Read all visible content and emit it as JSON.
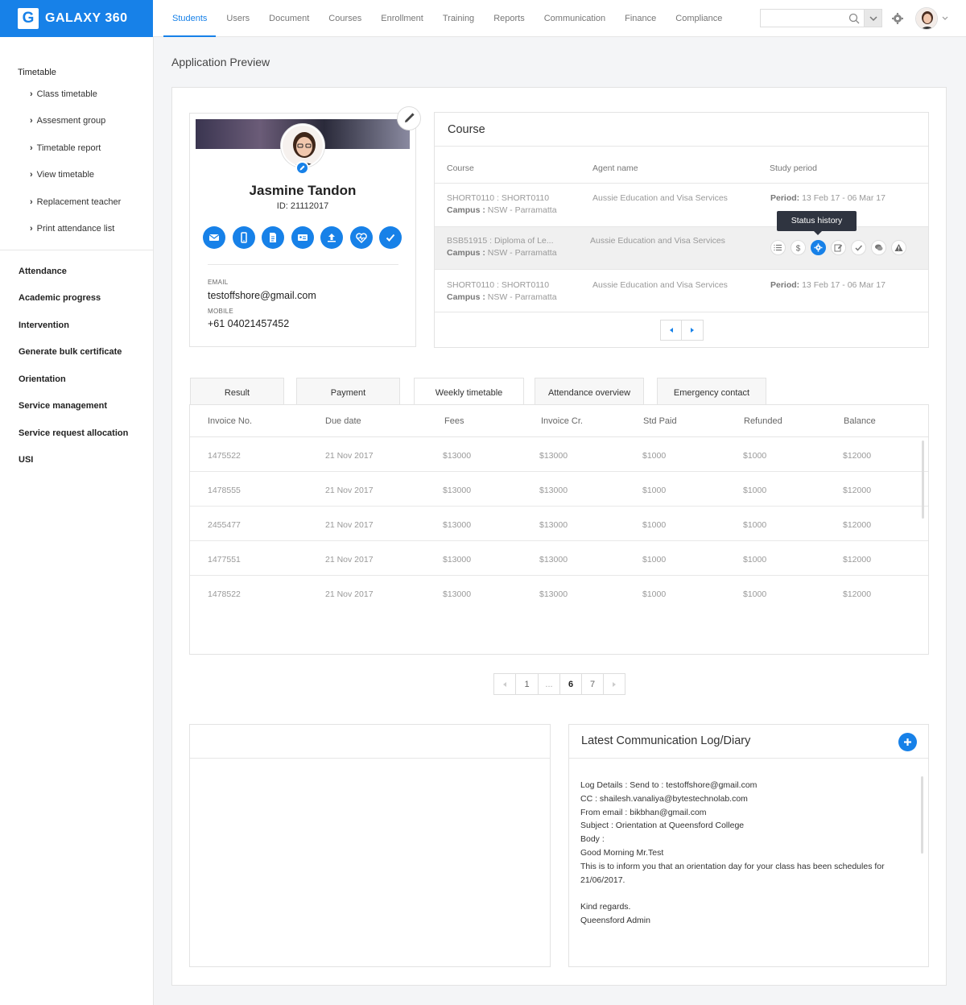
{
  "app": {
    "logo_letter": "G",
    "name": "GALAXY 360"
  },
  "nav": [
    "Students",
    "Users",
    "Document",
    "Courses",
    "Enrollment",
    "Training",
    "Reports",
    "Communication",
    "Finance",
    "Compliance"
  ],
  "search": {
    "placeholder": "",
    "value": ""
  },
  "sidebar": {
    "heading": "Timetable",
    "sub_items": [
      "Class timetable",
      "Assesment group",
      "Timetable report",
      "View timetable",
      "Replacement teacher",
      "Print attendance list"
    ],
    "sections": [
      "Attendance",
      "Academic progress",
      "Intervention",
      "Generate bulk certificate",
      "Orientation",
      "Service management",
      "Service request allocation",
      "USI"
    ]
  },
  "page_title": "Application Preview",
  "profile": {
    "name": "Jasmine Tandon",
    "id": "ID: 21112017",
    "email_label": "EMAIL",
    "email": "testoffshore@gmail.com",
    "mobile_label": "MOBILE",
    "mobile": "+61 04021457452",
    "actions": [
      "mail-icon",
      "mobile-icon",
      "document-icon",
      "id-card-icon",
      "upload-icon",
      "health-icon",
      "check-icon"
    ]
  },
  "course": {
    "title": "Course",
    "headers": [
      "Course",
      "Agent name",
      "Study period"
    ],
    "rows": [
      {
        "course": "SHORT0110 : SHORT0110",
        "campus_label": "Campus :",
        "campus": "NSW - Parramatta",
        "agent": "Aussie Education and Visa Services",
        "period_label": "Period:",
        "period": "13 Feb 17 - 06 Mar 17"
      },
      {
        "course": "BSB51915 : Diploma of Le...",
        "campus_label": "Campus :",
        "campus": "NSW - Parramatta",
        "agent": "Aussie Education and Visa Services",
        "period_label": "",
        "period": ""
      },
      {
        "course": "SHORT0110 : SHORT0110",
        "campus_label": "Campus :",
        "campus": "NSW - Parramatta",
        "agent": "Aussie Education and Visa Services",
        "period_label": "Period:",
        "period": "13 Feb 17 - 06 Mar 17"
      }
    ],
    "tooltip": "Status history",
    "row_actions": [
      "list-icon",
      "dollar-icon",
      "gear-icon",
      "edit-icon",
      "check-icon",
      "chat-icon",
      "warning-icon"
    ]
  },
  "tabs": [
    "Result",
    "Payment",
    "Weekly timetable",
    "Attendance overview",
    "Emergency contact"
  ],
  "invoice": {
    "headers": [
      "Invoice No.",
      "Due date",
      "Fees",
      "Invoice Cr.",
      "Std Paid",
      "Refunded",
      "Balance"
    ],
    "rows": [
      [
        "1475522",
        "21 Nov 2017",
        "$13000",
        "$13000",
        "$1000",
        "$1000",
        "$12000"
      ],
      [
        "1478555",
        "21 Nov 2017",
        "$13000",
        "$13000",
        "$1000",
        "$1000",
        "$12000"
      ],
      [
        "2455477",
        "21 Nov 2017",
        "$13000",
        "$13000",
        "$1000",
        "$1000",
        "$12000"
      ],
      [
        "1477551",
        "21 Nov 2017",
        "$13000",
        "$13000",
        "$1000",
        "$1000",
        "$12000"
      ],
      [
        "1478522",
        "21 Nov 2017",
        "$13000",
        "$13000",
        "$1000",
        "$1000",
        "$12000"
      ]
    ]
  },
  "pagination": {
    "pages": [
      "1",
      "...",
      "6",
      "7"
    ],
    "current": "6"
  },
  "log": {
    "title": "Latest Communication Log/Diary",
    "lines": [
      "Log Details : Send to : testoffshore@gmail.com",
      "CC : shailesh.vanaliya@bytestechnolab.com",
      "From email : bikbhan@gmail.com",
      "Subject : Orientation at Queensford College",
      "Body :",
      "Good Morning Mr.Test",
      "This is to inform you that an orientation day for your class has been schedules for 21/06/2017.",
      "",
      "Kind regards.",
      "Queensford Admin"
    ]
  },
  "colors": {
    "accent": "#1781e8",
    "tooltip_bg": "#2f3440"
  }
}
